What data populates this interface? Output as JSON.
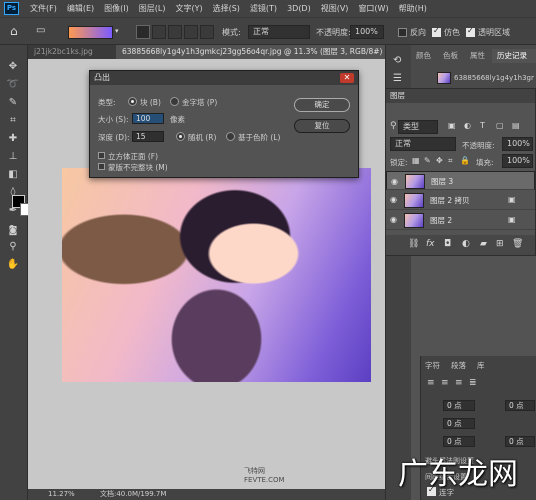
{
  "menubar": {
    "logo": "Ps",
    "items": [
      "文件(F)",
      "编辑(E)",
      "图像(I)",
      "图层(L)",
      "文字(Y)",
      "选择(S)",
      "滤镜(T)",
      "3D(D)",
      "视图(V)",
      "窗口(W)",
      "帮助(H)"
    ]
  },
  "options": {
    "mode_label": "模式:",
    "mode_value": "正常",
    "opacity_label": "不透明度:",
    "opacity_value": "100%",
    "reverse_label": "反向",
    "dither_label": "仿色",
    "transparency_label": "透明区域"
  },
  "tabs": [
    "j21jk2bc1ks.jpg",
    "63885668ly1g4y1h3gmkcj23gg56o4qr.jpg @ 11.3% (图层 3, RGB/8#) *"
  ],
  "dialog": {
    "title": "凸出",
    "type_label": "类型:",
    "type_block": "块 (B)",
    "type_pyramid": "金字塔 (P)",
    "size_label": "大小 (S):",
    "size_value": "100",
    "size_unit": "像素",
    "depth_label": "深度 (D):",
    "depth_value": "15",
    "random_label": "随机 (R)",
    "level_label": "基于色阶 (L)",
    "solid_front_label": "立方体正面 (F)",
    "mask_incomplete_label": "蒙版不完整块 (M)",
    "ok_label": "确定",
    "cancel_label": "复位"
  },
  "right_panel": {
    "tabs": [
      "颜色",
      "色板",
      "属性",
      "历史记录"
    ],
    "history_item": "63885668ly1g4y1h3gmkcj..."
  },
  "layers": {
    "title": "图层",
    "filter_label": "类型",
    "blend_mode": "正常",
    "opacity_label": "不透明度:",
    "opacity_value": "100%",
    "lock_label": "锁定:",
    "fill_label": "填充:",
    "fill_value": "100%",
    "items": [
      {
        "name": "图层 3",
        "selected": true
      },
      {
        "name": "图层 2 拷贝",
        "selected": false
      },
      {
        "name": "图层 2",
        "selected": false
      }
    ]
  },
  "props": {
    "tabs": [
      "字符",
      "段落",
      "库"
    ],
    "indent_values": [
      "0 点",
      "0 点",
      "0 点",
      "0 点",
      "0 点"
    ],
    "option_label": "避头尾法则设置",
    "spacing_label": "间距组合设置",
    "hyphen_label": "连字"
  },
  "status": {
    "zoom": "11.27%",
    "doc": "文档:40.0M/199.7M"
  },
  "watermark": {
    "small_cn": "飞特网",
    "small_en": "FEVTE.COM",
    "big": "广东龙网"
  },
  "colors": {
    "bg": "#535353",
    "panel": "#424242",
    "accent": "#31a8ff"
  }
}
